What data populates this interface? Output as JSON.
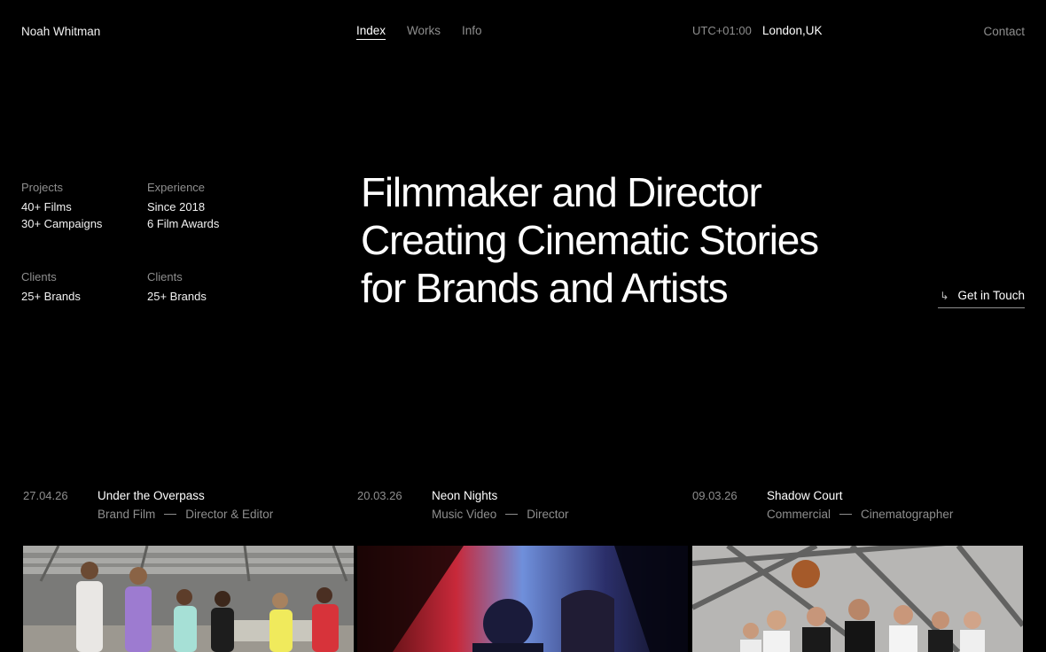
{
  "header": {
    "brand": "Noah Whitman",
    "nav": [
      {
        "label": "Index"
      },
      {
        "label": "Works"
      },
      {
        "label": "Info"
      }
    ],
    "timezone": "UTC+01:00",
    "location": "London,UK",
    "contact": "Contact"
  },
  "stats": [
    {
      "label": "Projects",
      "values": [
        "40+ Films",
        "30+ Campaigns"
      ]
    },
    {
      "label": "Experience",
      "values": [
        "Since 2018",
        "6 Film Awards"
      ]
    },
    {
      "label": "Clients",
      "values": [
        "25+ Brands"
      ]
    },
    {
      "label": "Clients",
      "values": [
        "25+ Brands"
      ]
    }
  ],
  "hero": {
    "lines": [
      "Filmmaker and Director",
      "Creating Cinematic Stories",
      "for Brands and Artists"
    ]
  },
  "cta": {
    "label": "Get in Touch",
    "icon": "arrow-down-right-icon"
  },
  "works": [
    {
      "date": "27.04.26",
      "title": "Under the Overpass",
      "type": "Brand Film",
      "role": "Director & Editor"
    },
    {
      "date": "20.03.26",
      "title": "Neon Nights",
      "type": "Music Video",
      "role": "Director"
    },
    {
      "date": "09.03.26",
      "title": "Shadow Court",
      "type": "Commercial",
      "role": "Cinematographer"
    }
  ]
}
